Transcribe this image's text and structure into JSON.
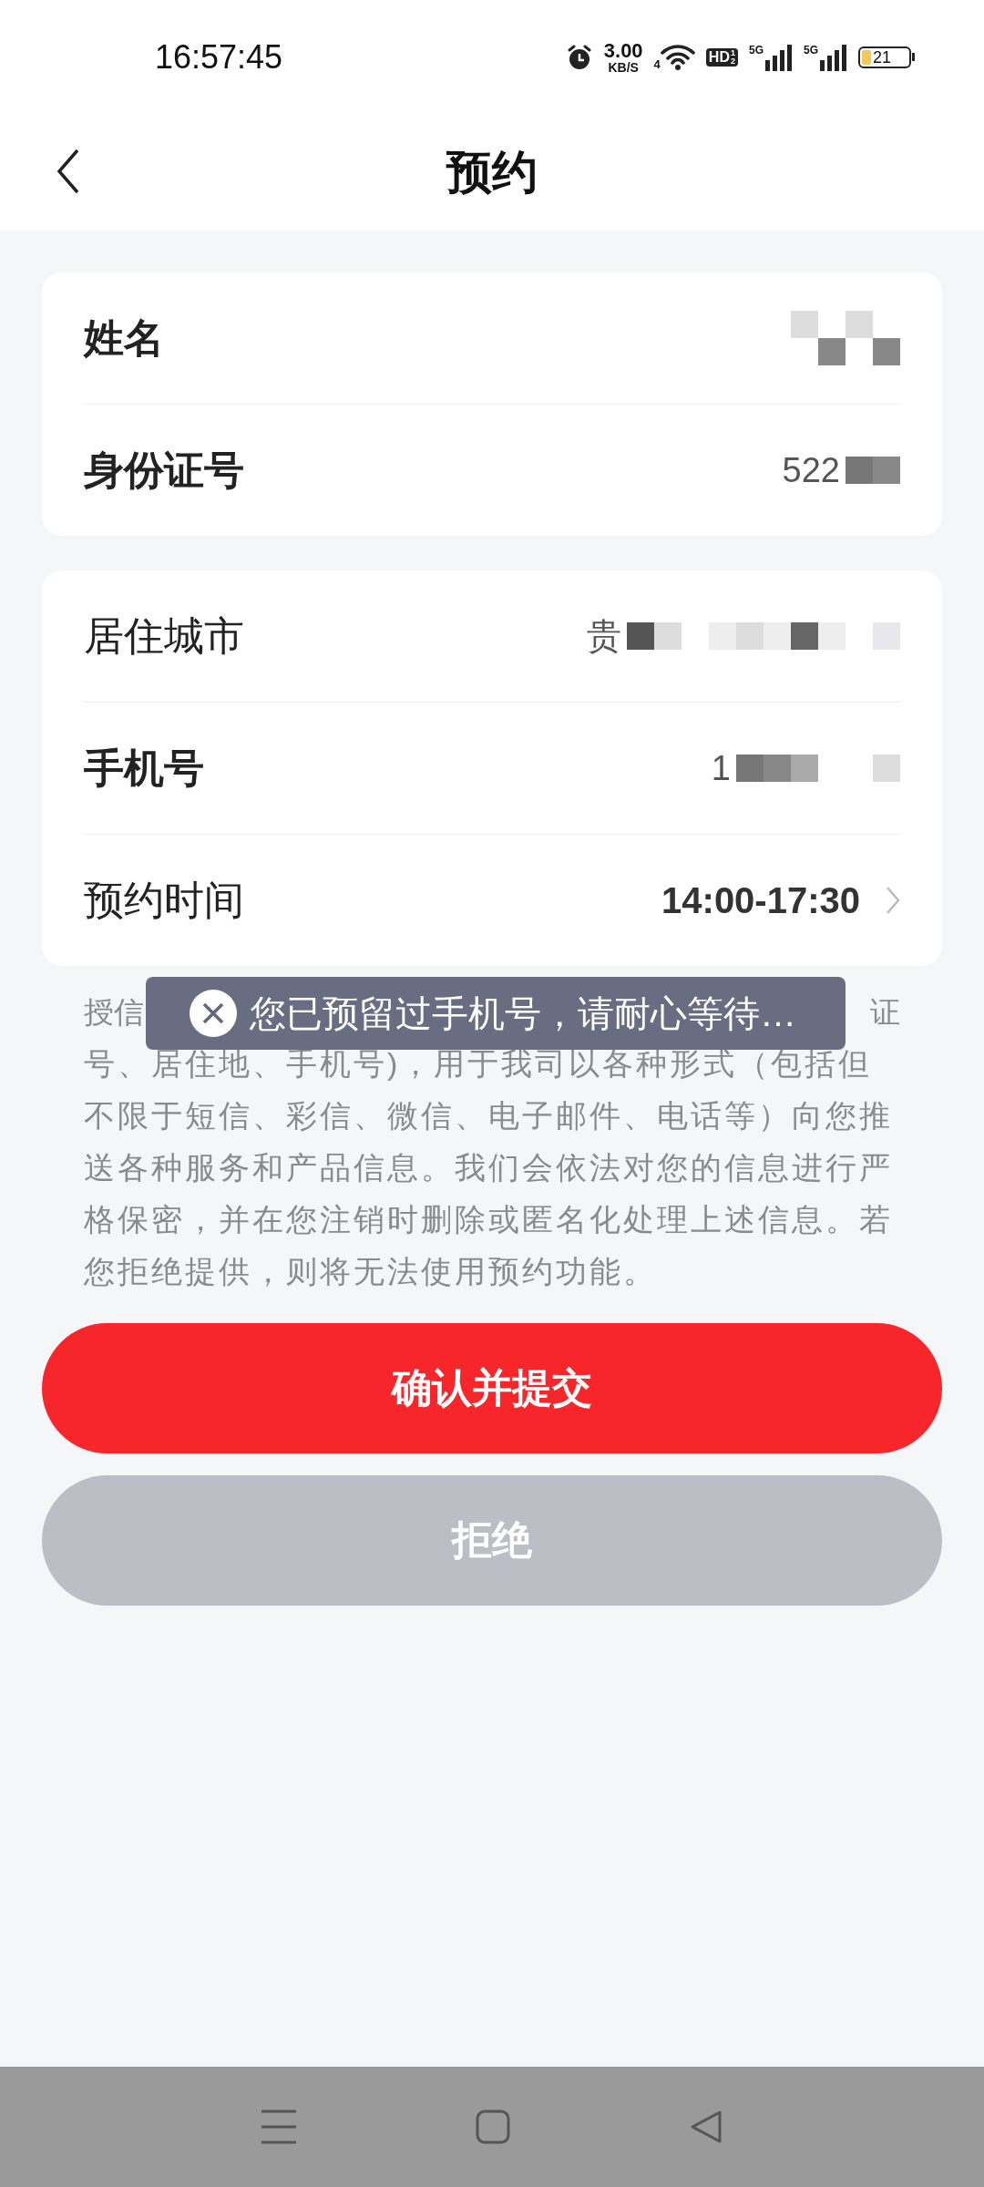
{
  "status_bar": {
    "time": "16:57:45",
    "speed": "3.00",
    "speed_unit": "KB/S",
    "wifi_label": "4",
    "hd": "HD",
    "hd_sims": [
      "1",
      "2"
    ],
    "signals": [
      {
        "label": "5G"
      },
      {
        "label": "5G"
      }
    ],
    "battery_reading": "21"
  },
  "header": {
    "title": "预约"
  },
  "cards": [
    {
      "rows": [
        {
          "label": "姓名",
          "bold": true,
          "masked": true
        },
        {
          "label": "身份证号",
          "bold": true,
          "value": "522",
          "masked": true
        }
      ]
    },
    {
      "rows": [
        {
          "label": "居住城市",
          "bold": false,
          "value": "贵",
          "masked": true
        },
        {
          "label": "手机号",
          "bold": true,
          "value": "1",
          "masked": true
        },
        {
          "label": "预约时间",
          "bold": false,
          "value": "14:00-17:30",
          "masked": false,
          "chevron": true
        }
      ]
    }
  ],
  "notice": {
    "first_line_start": "授信",
    "first_line_end": "证",
    "text": "号、居住地、手机号)，用于我司以各种形式（包括但不限于短信、彩信、微信、电子邮件、电话等）向您推送各种服务和产品信息。我们会依法对您的信息进行严格保密，并在您注销时删除或匿名化处理上述信息。若您拒绝提供，则将无法使用预约功能。"
  },
  "toast": {
    "message": "您已预留过手机号，请耐心等待…"
  },
  "buttons": [
    {
      "label": "确认并提交",
      "kind": "primary"
    },
    {
      "label": "拒绝",
      "kind": "secondary"
    }
  ]
}
